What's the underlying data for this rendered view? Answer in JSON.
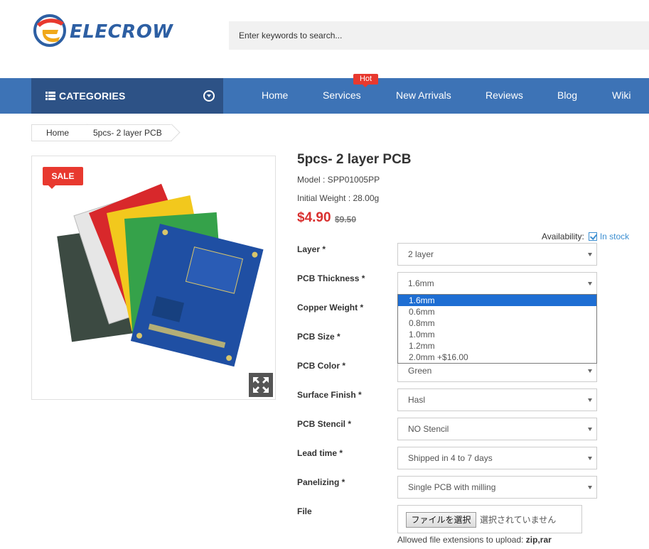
{
  "header": {
    "logo_text": "ELECROW",
    "search_placeholder": "Enter keywords to search..."
  },
  "nav": {
    "categories_label": "CATEGORIES",
    "hot_badge": "Hot",
    "items": [
      "Home",
      "Services",
      "New Arrivals",
      "Reviews",
      "Blog",
      "Wiki"
    ]
  },
  "breadcrumb": [
    "Home",
    "5pcs- 2 layer PCB"
  ],
  "product": {
    "sale_badge": "SALE",
    "title": "5pcs- 2 layer PCB",
    "model": "Model : SPP01005PP",
    "weight": "Initial Weight : 28.00g",
    "price": "$4.90",
    "old_price": "$9.50",
    "availability_label": "Availability:",
    "availability_value": "In stock"
  },
  "options": [
    {
      "label": "Layer *",
      "value": "2 layer"
    },
    {
      "label": "PCB Thickness *",
      "value": "1.6mm"
    },
    {
      "label": "Copper Weight *",
      "value": ""
    },
    {
      "label": "PCB Size *",
      "value": ""
    },
    {
      "label": "PCB Color *",
      "value": "Green"
    },
    {
      "label": "Surface Finish *",
      "value": "Hasl"
    },
    {
      "label": "PCB Stencil *",
      "value": "NO Stencil"
    },
    {
      "label": "Lead time *",
      "value": "Shipped in 4 to 7 days"
    },
    {
      "label": "Panelizing *",
      "value": "Single PCB with milling"
    }
  ],
  "thickness_dropdown": {
    "selected": "1.6mm",
    "options": [
      "1.6mm",
      "0.6mm",
      "0.8mm",
      "1.0mm",
      "1.2mm",
      "2.0mm +$16.00"
    ]
  },
  "file": {
    "label": "File",
    "button": "ファイルを選択",
    "status": "選択されていません",
    "allowed_prefix": "Allowed file extensions to upload: ",
    "allowed_ext": "zip,rar"
  },
  "colors": {
    "nav_bg": "#3d73b6",
    "categories_bg": "#2d5286",
    "price_red": "#d9302f",
    "stock_blue": "#3d8fd1",
    "dropdown_highlight": "#1e6ed3"
  },
  "icons": [
    "elecrow-logo",
    "list-icon",
    "chevron-circle-down-icon",
    "expand-icon",
    "checkbox-icon",
    "dropdown-arrow-icon"
  ]
}
